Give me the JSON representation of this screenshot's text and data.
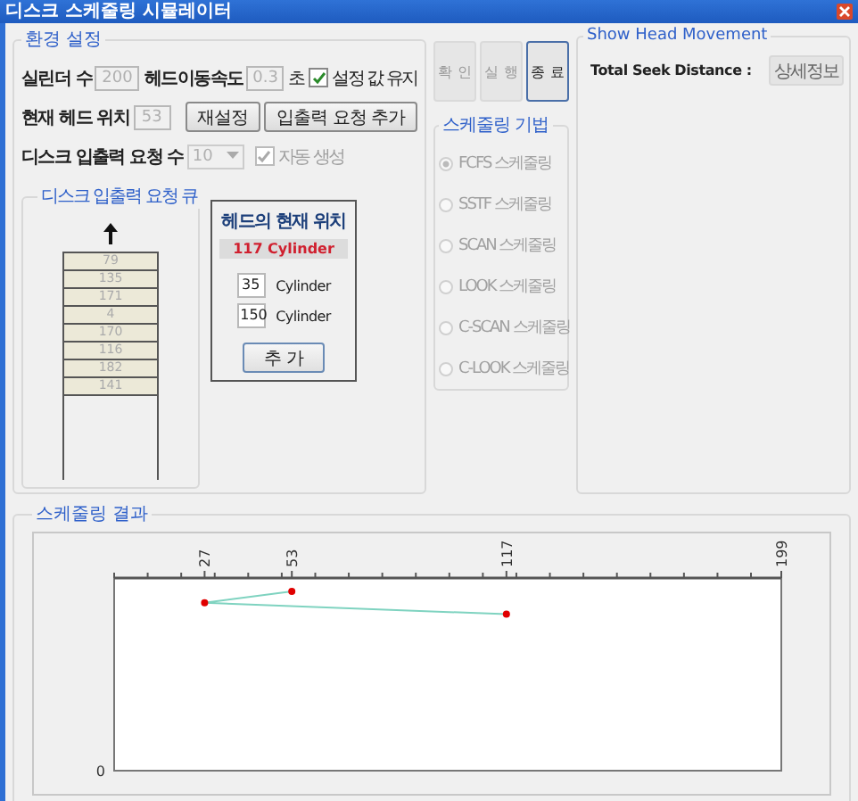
{
  "window": {
    "title": "디스크 스케줄링 시뮬레이터"
  },
  "settings": {
    "title": "환경 설정",
    "cylinders": {
      "label": "실린더 수",
      "value": "200",
      "disabled": true
    },
    "head_speed": {
      "label": "헤드이동속도",
      "value": "0.3",
      "unit": "초",
      "disabled": true
    },
    "keep_settings": {
      "label": "설정 값 유지",
      "checked": true
    },
    "head_position": {
      "label": "현재 헤드 위치",
      "value": "53",
      "disabled": true
    },
    "buttons": [
      "재설정",
      "입출력 요청 추가"
    ],
    "request_count": {
      "label": "디스크 입출력 요청 수",
      "value": "10",
      "disabled": true
    },
    "auto_generate": {
      "label": "자동 생성",
      "checked": true,
      "disabled": true
    },
    "queue": {
      "title": "디스크 입출력 요청 큐",
      "items": [
        "79",
        "135",
        "171",
        "4",
        "170",
        "116",
        "182",
        "141"
      ]
    },
    "head_panel": {
      "title": "헤드의 현재 위치",
      "current": "117 Cylinder",
      "inputs": [
        {
          "value": "35",
          "unit": "Cylinder"
        },
        {
          "value": "150",
          "unit": "Cylinder"
        }
      ],
      "button": "추 가"
    }
  },
  "actions": [
    {
      "label": "확 인",
      "disabled": true
    },
    {
      "label": "실 행",
      "disabled": true
    },
    {
      "label": "종 료",
      "disabled": false
    }
  ],
  "algorithms": {
    "title": "스케줄링 기법",
    "disabled": true,
    "options": [
      {
        "label": "FCFS 스케줄링",
        "selected": true
      },
      {
        "label": "SSTF 스케줄링",
        "selected": false
      },
      {
        "label": "SCAN 스케줄링",
        "selected": false
      },
      {
        "label": "LOOK 스케줄링",
        "selected": false
      },
      {
        "label": "C-SCAN 스케줄링",
        "selected": false
      },
      {
        "label": "C-LOOK 스케줄링",
        "selected": false
      }
    ]
  },
  "movement": {
    "title": "Show Head Movement",
    "total_label": "Total Seek Distance :",
    "details_button": "상세정보"
  },
  "result": {
    "title": "스케줄링 결과",
    "top_labels": [
      "27",
      "53",
      "117",
      "199"
    ],
    "corner_label": "0"
  }
}
